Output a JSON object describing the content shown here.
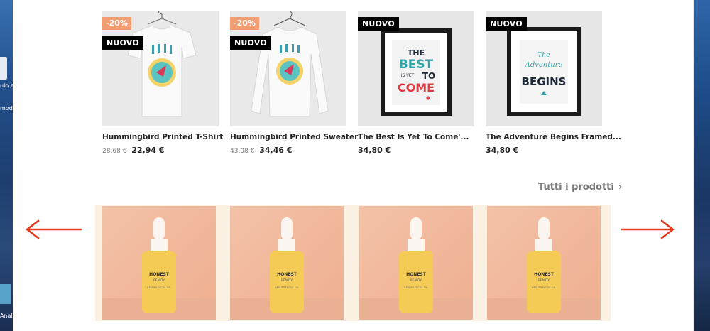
{
  "products": [
    {
      "name": "Hummingbird Printed T-Shirt",
      "old_price": "28,68 €",
      "price": "22,94 €",
      "discount": "-20%",
      "flag": "NUOVO"
    },
    {
      "name": "Hummingbird Printed Sweater",
      "old_price": "43,08 €",
      "price": "34,46 €",
      "discount": "-20%",
      "flag": "NUOVO"
    },
    {
      "name": "The Best Is Yet To Come'...",
      "price": "34,80 €",
      "flag": "NUOVO"
    },
    {
      "name": "The Adventure Begins Framed...",
      "price": "34,80 €",
      "flag": "NUOVO"
    }
  ],
  "poster1": {
    "line1": "THE",
    "line2": "BEST",
    "line3": "IS YET",
    "line4": "TO",
    "line5": "COME"
  },
  "poster2": {
    "line1": "The",
    "line2": "Adventure",
    "line3": "BEGINS"
  },
  "all_products_link": "Tutti i prodotti",
  "banner": {
    "brand": "HONEST",
    "sub": "BEAUTY",
    "label": "BEAUTY FACIAL OIL",
    "slides": 4
  },
  "desktop": {
    "left_labels": [
      "ulo.z",
      "mod",
      "Anal"
    ]
  },
  "colors": {
    "discount_badge": "#f39d72",
    "new_badge": "#000000",
    "arrow": "#e8361e",
    "banner_bg": "#faf1e3"
  },
  "icons": [
    "chevron-right-icon",
    "arrow-left-icon",
    "arrow-right-icon"
  ]
}
